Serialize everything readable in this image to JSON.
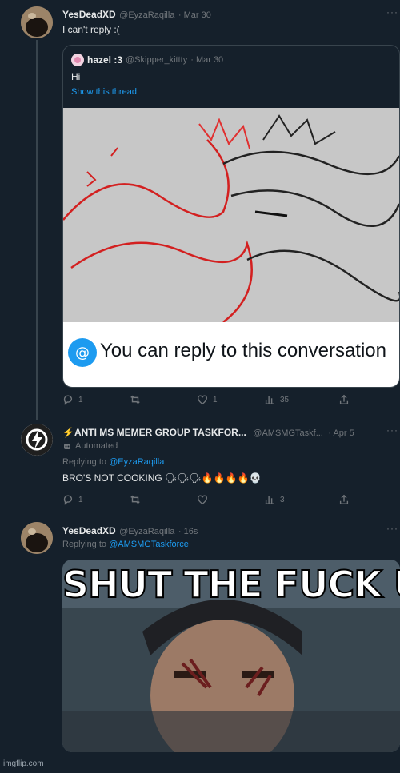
{
  "tweets": [
    {
      "name": "YesDeadXD",
      "handle": "@EyzaRaqilla",
      "time": "· Mar 30",
      "text": "I can't reply :(",
      "quote": {
        "name": "hazel :3",
        "handle": "@Skipper_kittty",
        "time": "· Mar 30",
        "text": "Hi",
        "show_thread": "Show this thread",
        "banner_text": "You can reply to this conversation"
      },
      "actions": {
        "replies": "1",
        "retweets": "",
        "likes": "1",
        "views": "35"
      }
    },
    {
      "name": "⚡ANTI MS MEMER GROUP TASKFOR...",
      "handle": "@AMSMGTaskf...",
      "time": "· Apr 5",
      "automated": "Automated",
      "replying_prefix": "Replying to",
      "replying_to": "@EyzaRaqilla",
      "text": "BRO'S NOT COOKING 🗣🗣🗣🔥🔥🔥🔥💀",
      "actions": {
        "replies": "1",
        "retweets": "",
        "likes": "",
        "views": "3"
      }
    },
    {
      "name": "YesDeadXD",
      "handle": "@EyzaRaqilla",
      "time": "· 16s",
      "replying_prefix": "Replying to",
      "replying_to": "@AMSMGTaskforce",
      "meme_text": "SHUT THE FUCK UP"
    }
  ],
  "watermark": "imgflip.com",
  "icons": [
    "reply-icon",
    "retweet-icon",
    "like-icon",
    "views-icon",
    "share-icon",
    "more-icon",
    "automated-icon"
  ]
}
